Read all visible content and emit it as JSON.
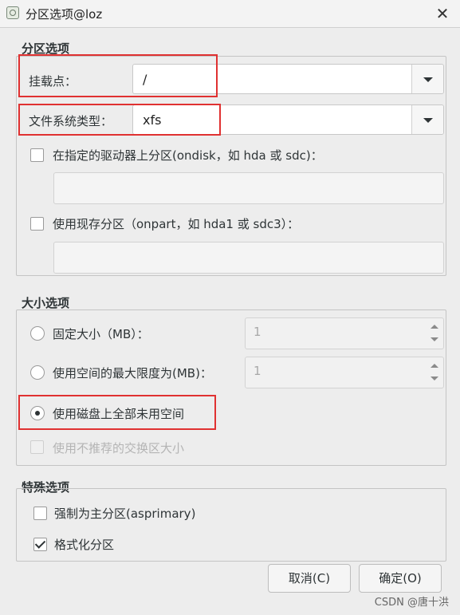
{
  "window": {
    "title": "分区选项@loz",
    "close_glyph": "✕",
    "icon": "app-icon"
  },
  "partition_options": {
    "group_title": "分区选项",
    "mount_point_label": "挂载点：",
    "mount_point_value": "/",
    "fs_type_label": "文件系统类型：",
    "fs_type_value": "xfs",
    "ondisk_label": "在指定的驱动器上分区(ondisk，如 hda 或 sdc)：",
    "ondisk_value": "",
    "onpart_label": "使用现存分区（onpart，如 hda1 或 sdc3）：",
    "onpart_value": ""
  },
  "size_options": {
    "group_title": "大小选项",
    "fixed_label": "固定大小（MB）：",
    "fixed_value": "1",
    "max_label": "使用空间的最大限度为(MB)：",
    "max_value": "1",
    "fill_label": "使用磁盘上全部未用空间",
    "swap_label": "使用不推荐的交换区大小",
    "selected": "fill"
  },
  "special_options": {
    "group_title": "特殊选项",
    "primary_label": "强制为主分区(asprimary)",
    "primary_checked": false,
    "format_label": "格式化分区",
    "format_checked": true
  },
  "buttons": {
    "cancel_label": "取消(C)",
    "ok_label": "确定(O)"
  },
  "watermark": "CSDN @唐十洪",
  "colors": {
    "highlight": "#e03131",
    "background": "#ededed"
  }
}
